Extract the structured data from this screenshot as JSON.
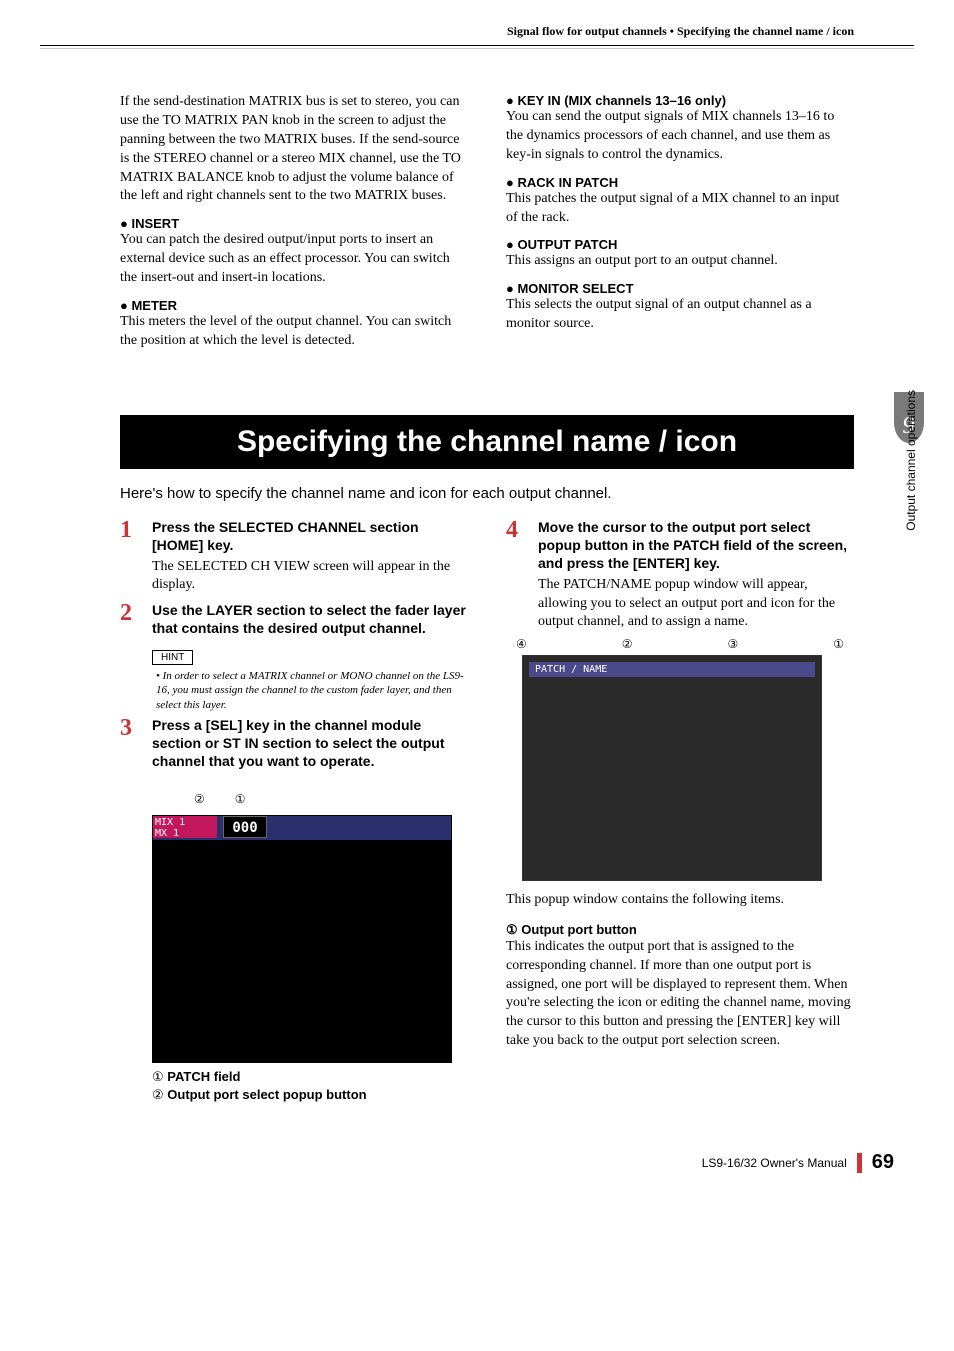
{
  "header": {
    "running_title": "Signal flow for output channels • Specifying the channel name / icon"
  },
  "upper": {
    "left": {
      "para1": "If the send-destination MATRIX bus is set to stereo, you can use the TO MATRIX PAN knob in the screen to adjust the panning between the two MATRIX buses. If the send-source is the STEREO channel or a stereo MIX channel, use the TO MATRIX BALANCE knob to adjust the volume balance of the left and right channels sent to the two MATRIX buses.",
      "insert_h": "INSERT",
      "insert_p": "You can patch the desired output/input ports to insert an external device such as an effect processor. You can switch the insert-out and insert-in locations.",
      "meter_h": "METER",
      "meter_p": "This meters the level of the output channel. You can switch the position at which the level is detected."
    },
    "right": {
      "keyin_h": "KEY IN (MIX channels 13–16 only)",
      "keyin_p": "You can send the output signals of MIX channels 13–16 to the dynamics processors of each channel, and use them as key-in signals to control the dynamics.",
      "rack_h": "RACK IN PATCH",
      "rack_p": "This patches the output signal of a MIX channel to an input of the rack.",
      "output_h": "OUTPUT PATCH",
      "output_p": "This assigns an output port to an output channel.",
      "mon_h": "MONITOR SELECT",
      "mon_p": "This selects the output signal of an output channel as a monitor source."
    }
  },
  "section_banner": "Specifying the channel name / icon",
  "intro": "Here's how to specify the channel name and icon for each output channel.",
  "steps_left": {
    "s1": {
      "num": "1",
      "title": "Press the SELECTED CHANNEL section [HOME] key.",
      "text": "The SELECTED CH VIEW screen will appear in the display."
    },
    "s2": {
      "num": "2",
      "title": "Use the LAYER section to select the fader layer that contains the desired output channel."
    },
    "hint": {
      "label": "HINT",
      "text": "In order to select a MATRIX channel or MONO channel on the LS9-16, you must assign the channel to the custom fader layer, and then select this layer."
    },
    "s3": {
      "num": "3",
      "title": "Press a [SEL] key in the channel module section or ST IN section to select the output channel that you want to operate."
    }
  },
  "fig1": {
    "callouts": {
      "a": "②",
      "b": "①"
    },
    "pink_top": "MIX 1",
    "pink_bottom": "MX 1",
    "counter": "000",
    "cap1_idx": "①",
    "cap1": "PATCH field",
    "cap2_idx": "②",
    "cap2": "Output port select popup button"
  },
  "steps_right": {
    "s4": {
      "num": "4",
      "title": "Move the cursor to the output port select popup button in the PATCH field of the screen, and press the [ENTER] key.",
      "text": "The PATCH/NAME popup window will appear, allowing you to select an output port and icon for the output channel, and to assign a name."
    }
  },
  "fig2": {
    "c1": "④",
    "c2": "②",
    "c3": "③",
    "c4": "①",
    "title": "PATCH / NAME",
    "after": "This popup window contains the following items.",
    "sub_h": "① Output port button",
    "sub_p": "This indicates the output port that is assigned to the corresponding channel. If more than one output port is assigned, one port will be displayed to represent them. When you're selecting the icon or editing the channel name, moving the cursor to this button and pressing the [ENTER] key will take you back to the output port selection screen."
  },
  "sidetab": {
    "label": "Output channel operations",
    "chapter": "6"
  },
  "footer": {
    "manual": "LS9-16/32  Owner's Manual",
    "page": "69"
  }
}
